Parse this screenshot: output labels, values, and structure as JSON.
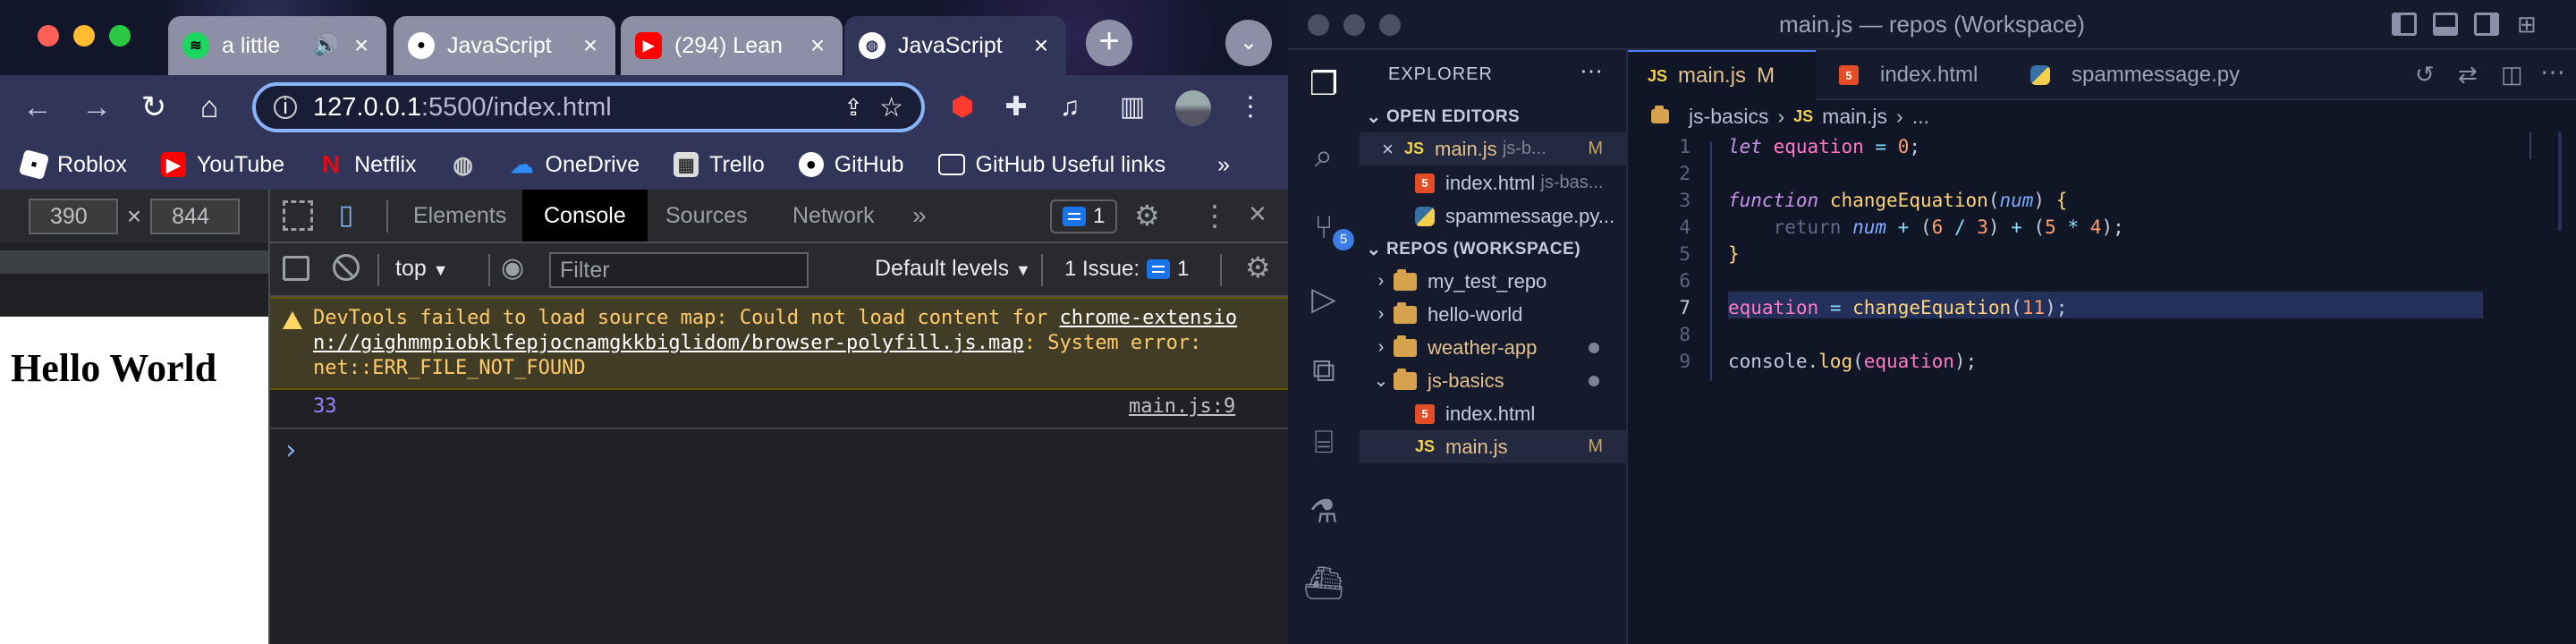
{
  "chrome": {
    "tabs": [
      {
        "title": "a little",
        "icon": "spotify-icon"
      },
      {
        "title": "JavaScript",
        "icon": "github-icon"
      },
      {
        "title": "(294) Lean",
        "icon": "youtube-icon"
      },
      {
        "title": "JavaScript",
        "icon": "globe-icon",
        "active": true
      }
    ],
    "new_tab": "+",
    "url_host": "127.0.0.1",
    "url_rest": ":5500/index.html",
    "bookmarks": [
      "Roblox",
      "YouTube",
      "Netflix",
      "",
      "OneDrive",
      "Trello",
      "GitHub",
      "GitHub Useful links"
    ],
    "bookmarks_more": "»",
    "device_width": "390",
    "device_height": "844",
    "device_times": "×",
    "page_heading": "Hello World"
  },
  "devtools": {
    "tabs": [
      "Elements",
      "Console",
      "Sources",
      "Network"
    ],
    "more": "»",
    "issues_count": "1",
    "context": "top",
    "filter_placeholder": "Filter",
    "levels": "Default levels",
    "issue_label": "1 Issue:",
    "issue_count2": "1",
    "warning_line1_a": "DevTools failed to load source map: Could not load content for ",
    "warning_line1_link": "chrome-extensio",
    "warning_line2_link": "n://gighmmpiobklfepjocnamgkkbiglidom/browser-polyfill.js.map",
    "warning_line2_b": ": System error:",
    "warning_line3": "net::ERR_FILE_NOT_FOUND",
    "log_value": "33",
    "log_source": "main.js:9",
    "prompt": "›"
  },
  "vscode": {
    "window_title": "main.js — repos (Workspace)",
    "explorer_title": "EXPLORER",
    "open_editors_title": "OPEN EDITORS",
    "open_editors": [
      {
        "name": "main.js",
        "detail": "js-b...",
        "badge": "M",
        "type": "js"
      },
      {
        "name": "index.html",
        "detail": "js-bas...",
        "type": "html"
      },
      {
        "name": "spammessage.py...",
        "detail": "",
        "type": "py"
      }
    ],
    "workspace_title": "REPOS (WORKSPACE)",
    "tree": [
      {
        "name": "my_test_repo",
        "kind": "folder"
      },
      {
        "name": "hello-world",
        "kind": "folder"
      },
      {
        "name": "weather-app",
        "kind": "folder",
        "dot": true
      },
      {
        "name": "js-basics",
        "kind": "folder-open",
        "dot": true
      },
      {
        "name": "index.html",
        "kind": "html"
      },
      {
        "name": "main.js",
        "kind": "js",
        "badge": "M"
      }
    ],
    "source_control_badge": "5",
    "editor_tabs": [
      {
        "name": "main.js",
        "badge": "M",
        "type": "js",
        "active": true
      },
      {
        "name": "index.html",
        "type": "html"
      },
      {
        "name": "spammessage.py",
        "type": "py"
      }
    ],
    "breadcrumbs": [
      "js-basics",
      "main.js",
      "..."
    ],
    "line_numbers": [
      "1",
      "2",
      "3",
      "4",
      "5",
      "6",
      "7",
      "8",
      "9"
    ]
  }
}
